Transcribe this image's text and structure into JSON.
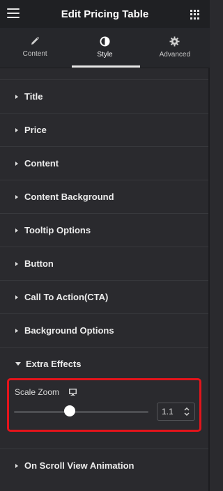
{
  "header": {
    "title": "Edit Pricing Table",
    "menu_icon": "hamburger-icon",
    "apps_icon": "grid-icon"
  },
  "tabs": [
    {
      "label": "Content",
      "icon": "pencil-icon",
      "active": false
    },
    {
      "label": "Style",
      "icon": "contrast-icon",
      "active": true
    },
    {
      "label": "Advanced",
      "icon": "gear-icon",
      "active": false
    }
  ],
  "sections": [
    {
      "label": "Title"
    },
    {
      "label": "Price"
    },
    {
      "label": "Content"
    },
    {
      "label": "Content Background"
    },
    {
      "label": "Tooltip Options"
    },
    {
      "label": "Button"
    },
    {
      "label": "Call To Action(CTA)"
    },
    {
      "label": "Background Options"
    },
    {
      "label": "Extra Effects",
      "expanded": true
    }
  ],
  "scale_zoom": {
    "label": "Scale Zoom",
    "device_icon": "monitor-icon",
    "value": "1.1",
    "slider_fraction": 0.43
  },
  "last_section": {
    "label": "On Scroll View Animation"
  },
  "colors": {
    "highlight": "#e3141b",
    "background": "#2a2a2e"
  }
}
